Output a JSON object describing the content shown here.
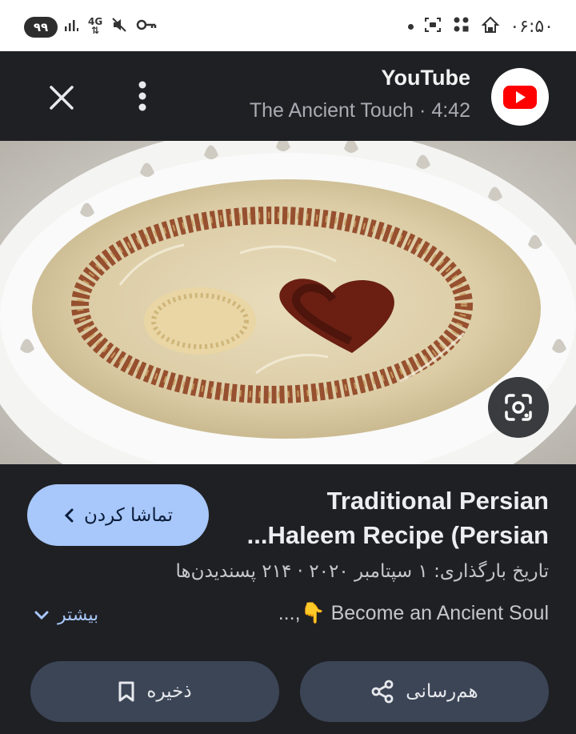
{
  "status_bar": {
    "battery": "۹۹",
    "time": "۰۶:۵۰",
    "network": "4G"
  },
  "header": {
    "source_name": "YouTube",
    "channel": "The Ancient Touch",
    "separator": "·",
    "duration": "4:42"
  },
  "video": {
    "title_line1": "Traditional Persian",
    "title_line2": "Haleem Recipe (Persian...",
    "meta": "تاریخ بارگذاری: ۱ سپتامبر ۲۰۲۰ · ۲۱۴ پسندیدن‌ها",
    "description": "Become an Ancient Soul 👇,..."
  },
  "actions": {
    "watch_label": "تماشا کردن",
    "more_label": "بیشتر",
    "save_label": "ذخیره",
    "share_label": "هم‌رسانی"
  },
  "colors": {
    "background": "#1f2024",
    "accent": "#a8c7fa",
    "youtube_red": "#ff0000",
    "pill_bg": "#3b4556"
  },
  "icons": [
    "close-icon",
    "more-vert-icon",
    "youtube-icon",
    "lens-icon",
    "chevron-left-icon",
    "chevron-down-icon",
    "bookmark-icon",
    "share-icon"
  ]
}
